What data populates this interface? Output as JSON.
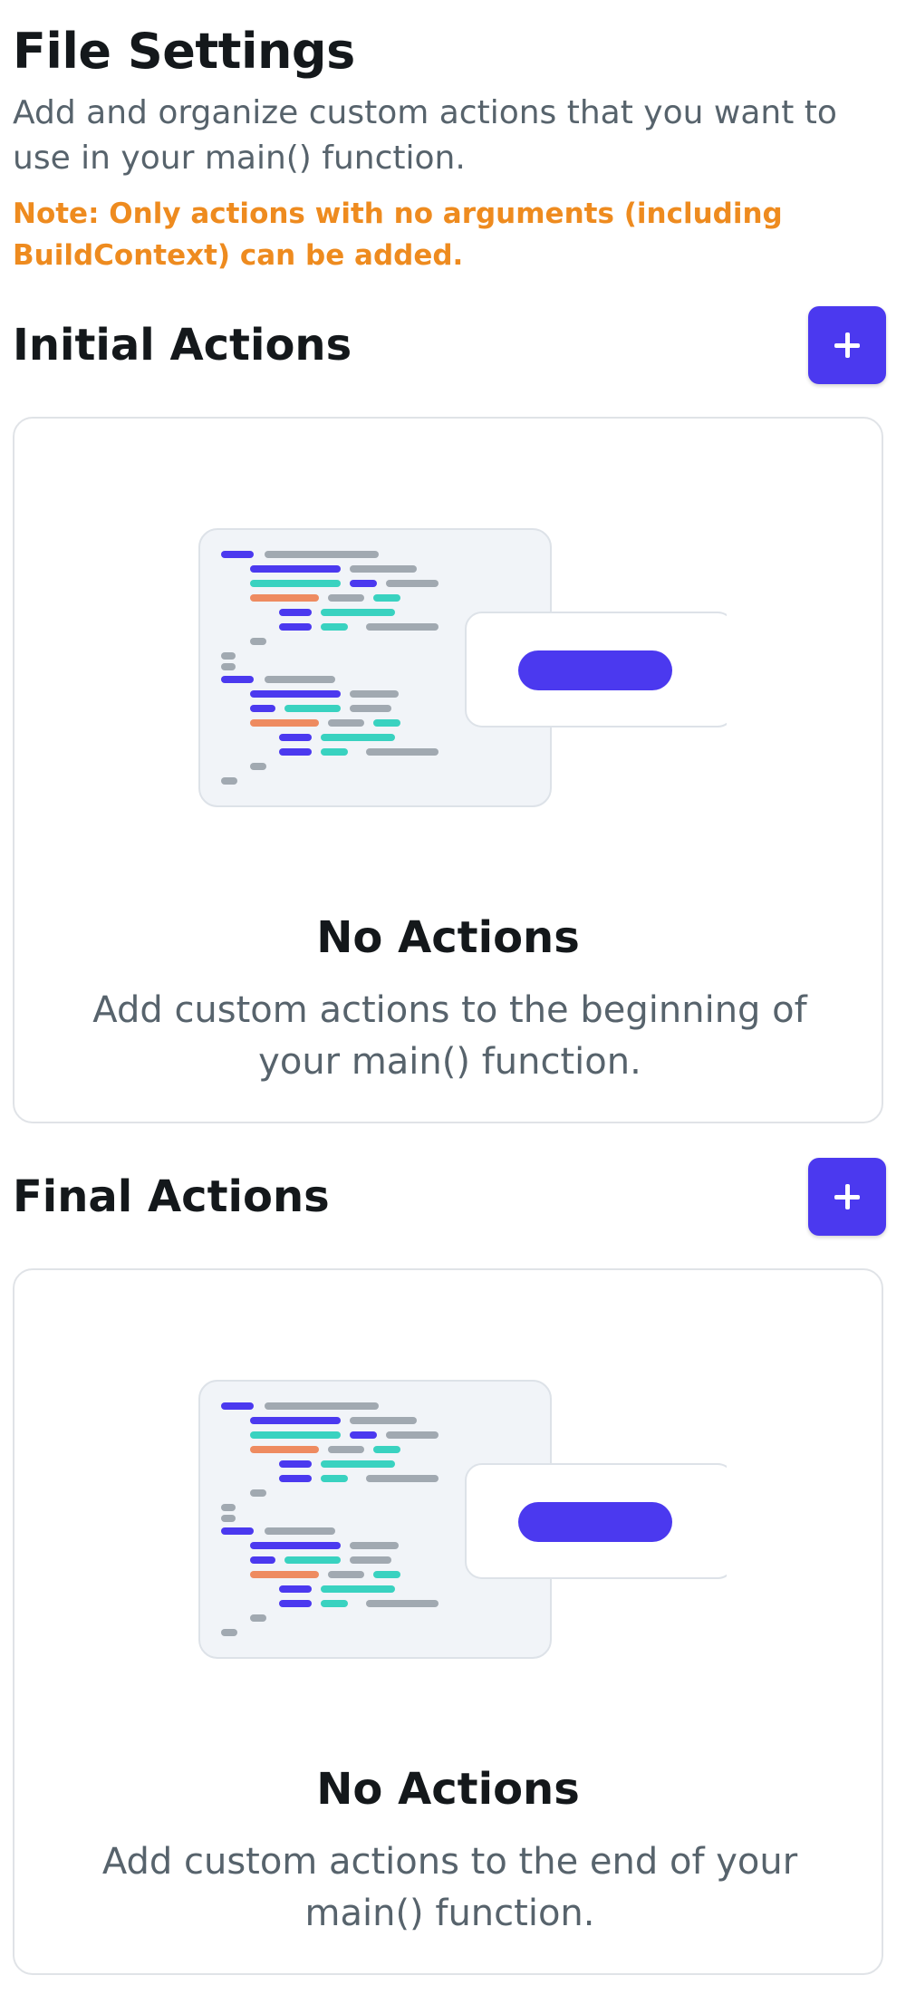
{
  "page": {
    "title": "File Settings",
    "description": "Add and organize custom actions that you want to use in your main() function.",
    "note": "Note: Only actions with no arguments (including BuildContext) can be added."
  },
  "sections": [
    {
      "title": "Initial Actions",
      "add_button_icon": "plus-icon",
      "empty_state": {
        "title": "No Actions",
        "text": "Add custom actions to the beginning of your main() function."
      }
    },
    {
      "title": "Final Actions",
      "add_button_icon": "plus-icon",
      "empty_state": {
        "title": "No Actions",
        "text": "Add custom actions to the end of your main() function."
      }
    }
  ],
  "colors": {
    "accent": "#4b39ef",
    "note": "#ee8b1f",
    "secondary_text": "#57636c",
    "card_border": "#e0e3e7",
    "code_teal": "#39d2c0",
    "code_orange": "#ee8b60",
    "code_gray": "#a1a9b1",
    "illustration_bg": "#f1f4f8"
  }
}
